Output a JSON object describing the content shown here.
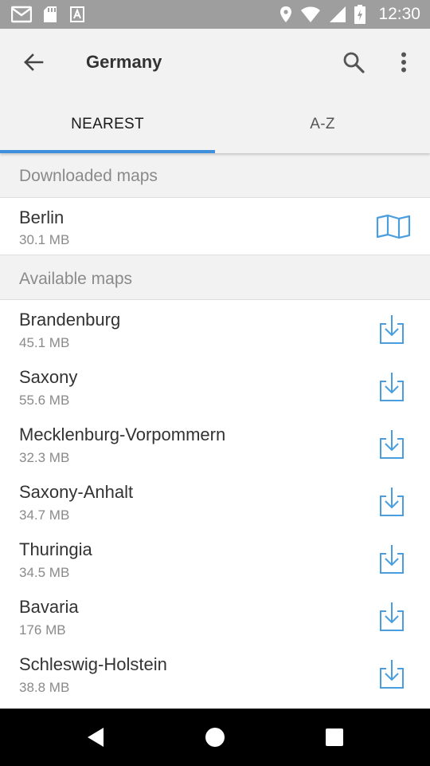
{
  "status_bar": {
    "time": "12:30",
    "icons": [
      "gmail-icon",
      "sd-card-icon",
      "app-store-icon",
      "location-icon",
      "wifi-icon",
      "signal-icon",
      "battery-icon"
    ]
  },
  "app_bar": {
    "title": "Germany",
    "back_icon": "arrow-back-icon",
    "search_icon": "search-icon",
    "overflow_icon": "more-vert-icon"
  },
  "tabs": [
    {
      "label": "NEAREST",
      "active": true
    },
    {
      "label": "A-Z",
      "active": false
    }
  ],
  "downloaded": {
    "header": "Downloaded maps",
    "items": [
      {
        "name": "Berlin",
        "size": "30.1 MB",
        "icon": "map-icon"
      }
    ]
  },
  "available": {
    "header": "Available maps",
    "items": [
      {
        "name": "Brandenburg",
        "size": "45.1 MB",
        "icon": "download-icon"
      },
      {
        "name": "Saxony",
        "size": "55.6 MB",
        "icon": "download-icon"
      },
      {
        "name": "Mecklenburg-Vorpommern",
        "size": "32.3 MB",
        "icon": "download-icon"
      },
      {
        "name": "Saxony-Anhalt",
        "size": "34.7 MB",
        "icon": "download-icon"
      },
      {
        "name": "Thuringia",
        "size": "34.5 MB",
        "icon": "download-icon"
      },
      {
        "name": "Bavaria",
        "size": "176 MB",
        "icon": "download-icon"
      },
      {
        "name": "Schleswig-Holstein",
        "size": "38.8 MB",
        "icon": "download-icon"
      }
    ]
  },
  "nav_bar": {
    "icons": [
      "nav-back-icon",
      "nav-home-icon",
      "nav-recents-icon"
    ]
  },
  "colors": {
    "accent": "#3f8fdc",
    "status_bar": "#9e9e9e",
    "app_bar": "#f2f2f2",
    "icon_blue": "#4a9ee0"
  }
}
